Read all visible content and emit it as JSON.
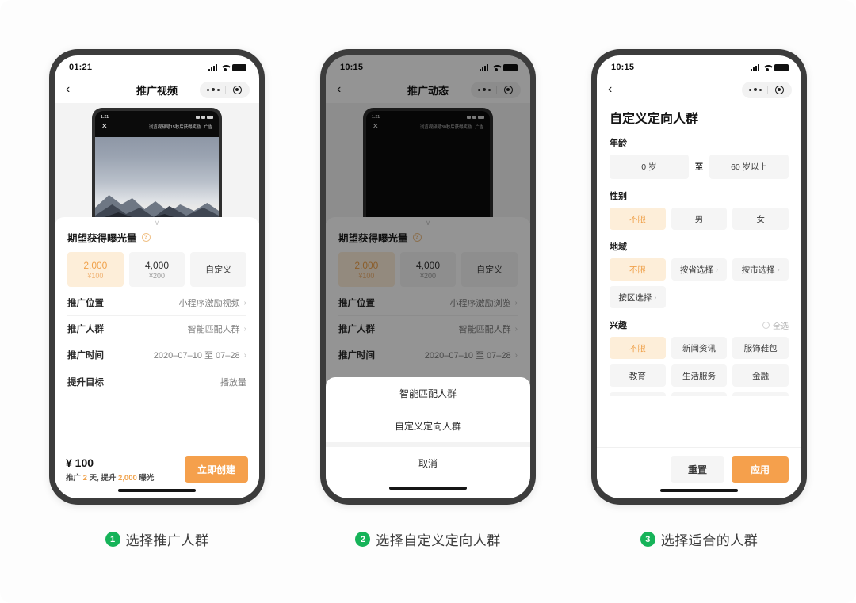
{
  "phone1": {
    "status": {
      "time": "01:21"
    },
    "nav": {
      "back": "‹",
      "title": "推广视频"
    },
    "preview": {
      "time": "1:21",
      "close": "✕",
      "banner": "浏览视频号15秒后获得奖励",
      "ad": "广告"
    },
    "grabber": "∨",
    "section_title": "期望获得曝光量",
    "help_icon": "?",
    "chips": [
      {
        "name": "2,000",
        "price": "¥100",
        "selected": true
      },
      {
        "name": "4,000",
        "price": "¥200",
        "selected": false
      },
      {
        "name": "自定义",
        "price": "",
        "selected": false
      }
    ],
    "rows": [
      {
        "label": "推广位置",
        "value": "小程序激励视频",
        "chevron": "›"
      },
      {
        "label": "推广人群",
        "value": "智能匹配人群",
        "chevron": "›"
      },
      {
        "label": "推广时间",
        "value": "2020–07–10 至 07–28",
        "chevron": "›"
      },
      {
        "label": "提升目标",
        "value": "播放量",
        "chevron": ""
      }
    ],
    "footer": {
      "price": "¥ 100",
      "sub_a": "推广 ",
      "sub_days": "2",
      "sub_b": " 天, 提升 ",
      "sub_imp": "2,000",
      "sub_c": " 曝光",
      "cta": "立即创建"
    }
  },
  "phone2": {
    "status": {
      "time": "10:15"
    },
    "nav": {
      "back": "‹",
      "title": "推广动态"
    },
    "preview": {
      "time": "1:21",
      "close": "✕",
      "banner": "浏览视频号30秒后获得奖励",
      "ad": "广告"
    },
    "grabber": "∨",
    "section_title": "期望获得曝光量",
    "help_icon": "?",
    "chips": [
      {
        "name": "2,000",
        "price": "¥100",
        "selected": true
      },
      {
        "name": "4,000",
        "price": "¥200",
        "selected": false
      },
      {
        "name": "自定义",
        "price": "",
        "selected": false
      }
    ],
    "rows": [
      {
        "label": "推广位置",
        "value": "小程序激励浏览",
        "chevron": "›"
      },
      {
        "label": "推广人群",
        "value": "智能匹配人群",
        "chevron": "›"
      },
      {
        "label": "推广时间",
        "value": "2020–07–10 至 07–28",
        "chevron": "›"
      }
    ],
    "actionsheet": {
      "options": [
        "智能匹配人群",
        "自定义定向人群"
      ],
      "cancel": "取消"
    }
  },
  "phone3": {
    "status": {
      "time": "10:15"
    },
    "nav": {
      "back": "‹"
    },
    "title": "自定义定向人群",
    "age": {
      "label": "年龄",
      "from": "0 岁",
      "sep": "至",
      "to": "60 岁以上"
    },
    "gender": {
      "label": "性别",
      "options": [
        {
          "text": "不限",
          "selected": true
        },
        {
          "text": "男",
          "selected": false
        },
        {
          "text": "女",
          "selected": false
        }
      ]
    },
    "region": {
      "label": "地域",
      "options": [
        {
          "text": "不限",
          "selected": true,
          "chevron": ""
        },
        {
          "text": "按省选择",
          "selected": false,
          "chevron": "›"
        },
        {
          "text": "按市选择",
          "selected": false,
          "chevron": "›"
        },
        {
          "text": "按区选择",
          "selected": false,
          "chevron": "›"
        }
      ]
    },
    "interest": {
      "label": "兴趣",
      "select_all": "全选",
      "options": [
        {
          "text": "不限",
          "selected": true
        },
        {
          "text": "新闻资讯",
          "selected": false
        },
        {
          "text": "服饰鞋包",
          "selected": false
        },
        {
          "text": "教育",
          "selected": false
        },
        {
          "text": "生活服务",
          "selected": false
        },
        {
          "text": "金融",
          "selected": false
        }
      ]
    },
    "footer": {
      "reset": "重置",
      "apply": "应用"
    }
  },
  "captions": [
    {
      "badge": "1",
      "text": "选择推广人群"
    },
    {
      "badge": "2",
      "text": "选择自定义定向人群"
    },
    {
      "badge": "3",
      "text": "选择适合的人群"
    }
  ],
  "colors": {
    "accent_orange": "#f5a04c",
    "chip_selected_bg": "#fdeed9",
    "badge_green": "#16b359",
    "frame": "#3c3c3c"
  }
}
